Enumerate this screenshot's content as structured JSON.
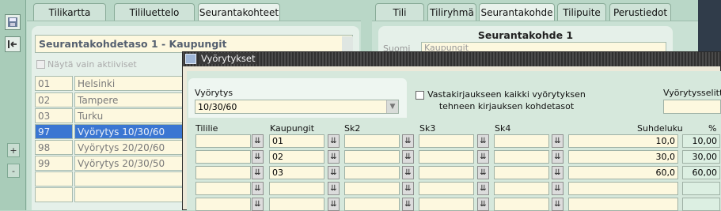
{
  "left_tabs": [
    "Tilikartta",
    "Tililuettelo",
    "Seurantakohteet"
  ],
  "right_tabs": [
    "Tili",
    "Tiliryhmä",
    "Seurantakohde",
    "Tilipuite",
    "Perustiedot"
  ],
  "left_panel": {
    "title": "Seurantakohdetaso 1 - Kaupungit",
    "checkbox_label": "Näytä vain aktiiviset",
    "rows": [
      {
        "code": "01",
        "name": "Helsinki"
      },
      {
        "code": "02",
        "name": "Tampere"
      },
      {
        "code": "03",
        "name": "Turku"
      },
      {
        "code": "97",
        "name": "Vyörytys 10/30/60"
      },
      {
        "code": "98",
        "name": "Vyörytys 20/20/60"
      },
      {
        "code": "99",
        "name": "Vyörytys 20/30/50"
      }
    ]
  },
  "right_panel": {
    "title": "Seurantakohde 1",
    "field_label": "Suomi",
    "field_value": "Kaupungit"
  },
  "rail": {
    "plus": "+",
    "minus": "-"
  },
  "modal": {
    "title": "Vyörytykset",
    "vyorytys_label": "Vyörytys",
    "vyorytys_value": "10/30/60",
    "checkbox_text_1": "Vastakirjaukseen kaikki vyörytyksen",
    "checkbox_text_2": "tehneen kirjauksen kohdetasot",
    "selite_label": "Vyörytysselitte",
    "columns": {
      "tili": "Tililie",
      "kaupungit": "Kaupungit",
      "sk2": "Sk2",
      "sk3": "Sk3",
      "sk4": "Sk4",
      "suhdeluku": "Suhdeluku",
      "pct": "%"
    },
    "rows": [
      {
        "kaupunki": "01",
        "suhde": "10,0",
        "pct": "10,00"
      },
      {
        "kaupunki": "02",
        "suhde": "30,0",
        "pct": "30,00"
      },
      {
        "kaupunki": "03",
        "suhde": "60,0",
        "pct": "60,00"
      },
      {
        "kaupunki": "",
        "suhde": "",
        "pct": ""
      },
      {
        "kaupunki": "",
        "suhde": "",
        "pct": ""
      }
    ]
  }
}
